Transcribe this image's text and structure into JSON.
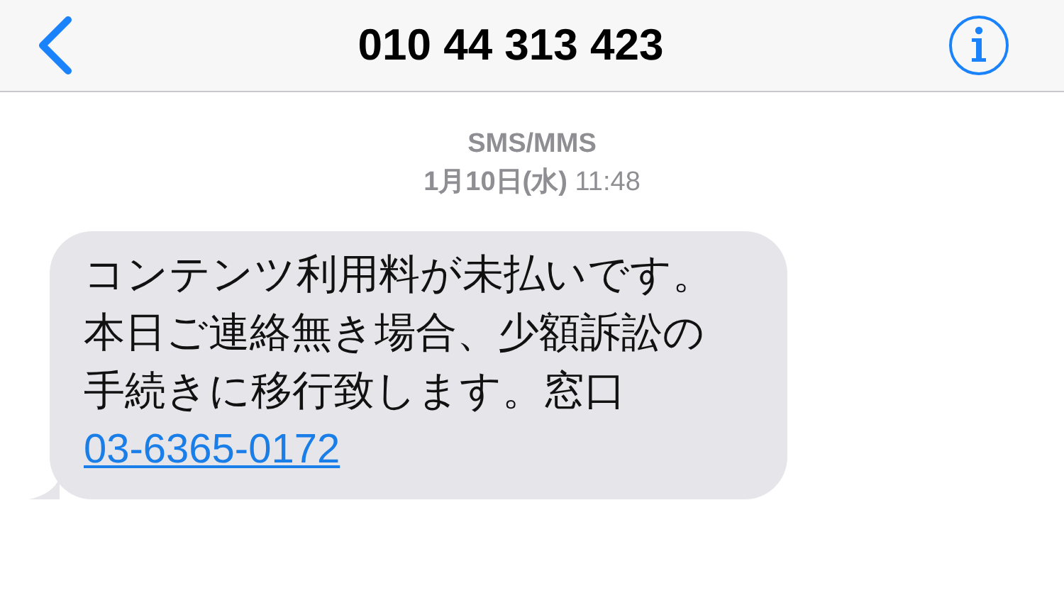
{
  "header": {
    "title": "010 44 313 423"
  },
  "thread": {
    "service": "SMS/MMS",
    "timestamp": "**1月10日(水)** 11:48"
  },
  "message": {
    "text": "コンテンツ利用料が未払いです。本日ご連絡無き場合、少額訴訟の手続きに移行致します。窓口",
    "link": "03-6365-0172"
  }
}
